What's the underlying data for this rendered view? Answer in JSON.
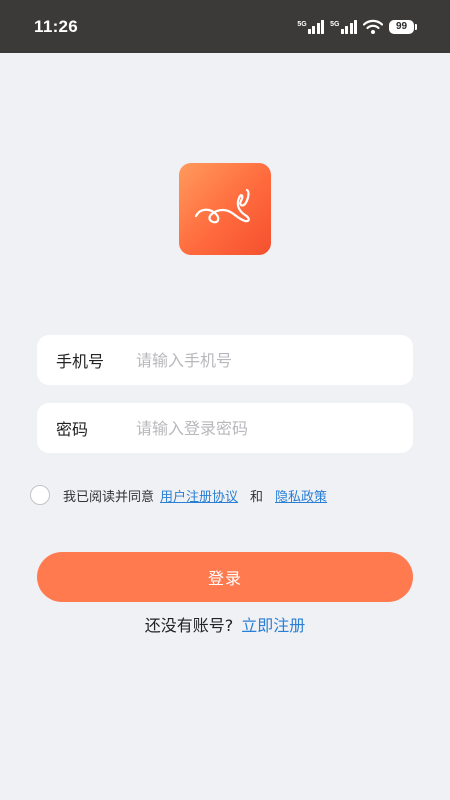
{
  "status_bar": {
    "time": "11:26",
    "signal1_label": "5G",
    "signal2_label": "5G",
    "battery": "99"
  },
  "login": {
    "phone_label": "手机号",
    "phone_placeholder": "请输入手机号",
    "password_label": "密码",
    "password_placeholder": "请输入登录密码",
    "agreement_prefix": "我已阅读并同意",
    "user_agreement": "用户注册协议",
    "and": "和",
    "privacy_policy": "隐私政策",
    "login_button": "登录",
    "no_account": "还没有账号?",
    "register_link": "立即注册"
  },
  "colors": {
    "accent": "#ff7a4f",
    "link": "#2a7fd4",
    "background": "#f0f1f5",
    "status_bar": "#3b3a39"
  }
}
